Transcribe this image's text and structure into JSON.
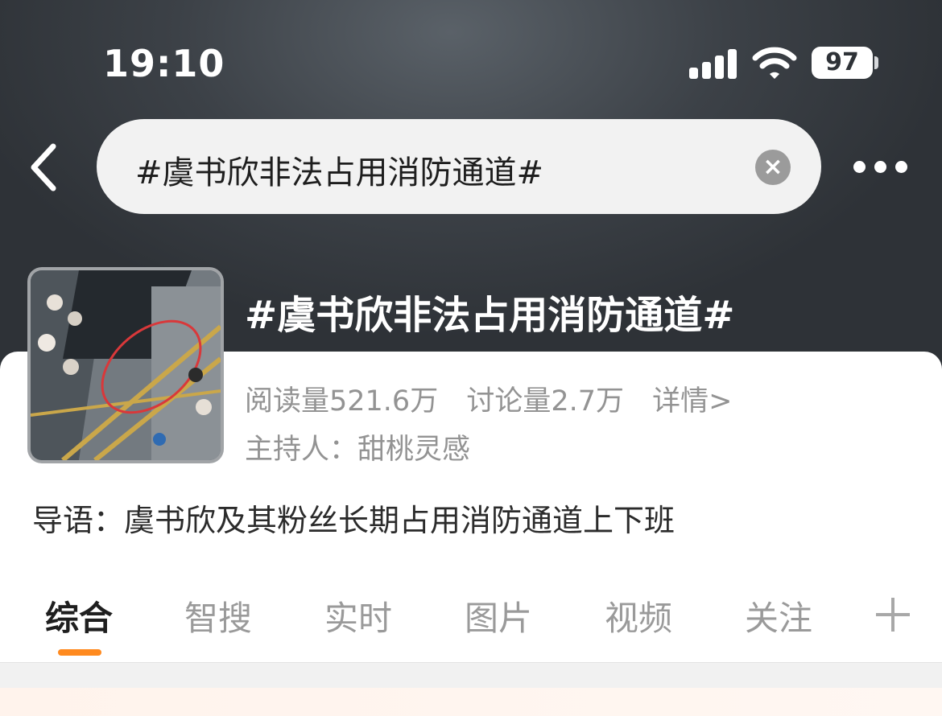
{
  "status_bar": {
    "time": "19:10",
    "battery": "97",
    "icons": [
      "signal-icon",
      "wifi-icon",
      "battery-icon"
    ]
  },
  "nav": {
    "back_icon": "chevron-left-icon",
    "search_text": "#虞书欣非法占用消防通道#",
    "clear_icon": "clear-icon",
    "clear_glyph": "×",
    "more_icon": "more-icon"
  },
  "topic": {
    "title": "#虞书欣非法占用消防通道#",
    "reads": "阅读量521.6万",
    "discussions": "讨论量2.7万",
    "details": "详情>",
    "host": "主持人：甜桃灵感",
    "guide": "导语：虞书欣及其粉丝长期占用消防通道上下班"
  },
  "tabs": {
    "items": [
      {
        "label": "综合",
        "active": true
      },
      {
        "label": "智搜",
        "active": false
      },
      {
        "label": "实时",
        "active": false
      },
      {
        "label": "图片",
        "active": false
      },
      {
        "label": "视频",
        "active": false
      },
      {
        "label": "关注",
        "active": false
      }
    ],
    "add_icon": "plus-icon"
  },
  "colors": {
    "accent": "#ff8a1f",
    "header_bg": "#3c4147",
    "muted_text": "#939393"
  }
}
